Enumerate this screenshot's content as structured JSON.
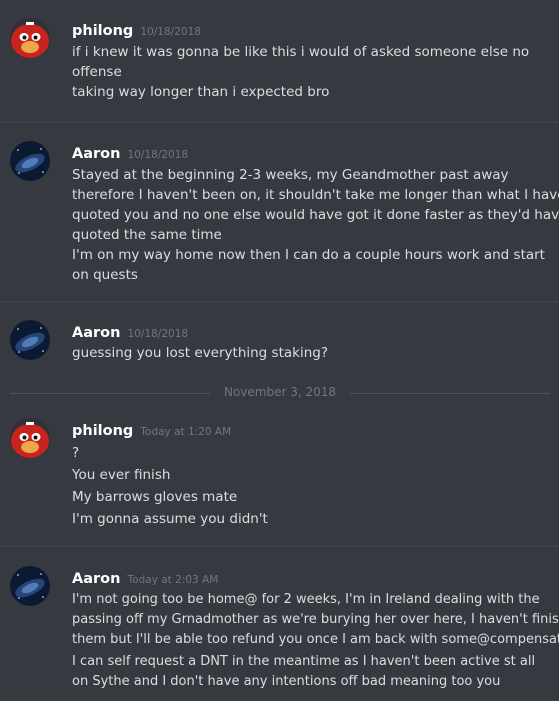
{
  "day_divider": "November 3, 2018",
  "groups": [
    {
      "author": "philong",
      "timestamp": "10/18/2018",
      "avatar": "ugandan-knuckles-avatar",
      "lines": [
        "if i knew it was gonna be like this i would of asked someone else no",
        "offense",
        "taking way longer than i expected bro"
      ]
    },
    {
      "author": "Aaron",
      "timestamp": "10/18/2018",
      "avatar": "galaxy-avatar",
      "lines": [
        "Stayed at the beginning 2-3 weeks, my Geandmother past away",
        "therefore I haven't been on, it shouldn't take me longer than what I have",
        "quoted you and no one else would have got it done faster as they'd have",
        "quoted the same time",
        "I'm on my way home now then I can do a couple hours work and start",
        "on quests"
      ]
    },
    {
      "author": "Aaron",
      "timestamp": "10/18/2018",
      "avatar": "galaxy-avatar",
      "lines": [
        "guessing you lost everything staking?"
      ]
    },
    {
      "author": "philong",
      "timestamp": "Today at 1:20 AM",
      "avatar": "ugandan-knuckles-avatar",
      "lines": [
        "?",
        "You ever finish",
        "My barrows gloves mate",
        "I'm gonna assume you didn't"
      ]
    },
    {
      "author": "Aaron",
      "timestamp": "Today at 2:03 AM",
      "avatar": "galaxy-avatar",
      "lines": [
        "I'm not going too be home@ for 2 weeks, I'm in Ireland dealing with the",
        "passing off my Grnadmother as we're burying her over here, I haven't finished",
        "them but I'll be able too refund you once I am back with some@compensation",
        "I can self request a DNT in the meantime as I haven't been active st all",
        "on Sythe and I don't have any intentions off bad meaning too you"
      ]
    }
  ]
}
